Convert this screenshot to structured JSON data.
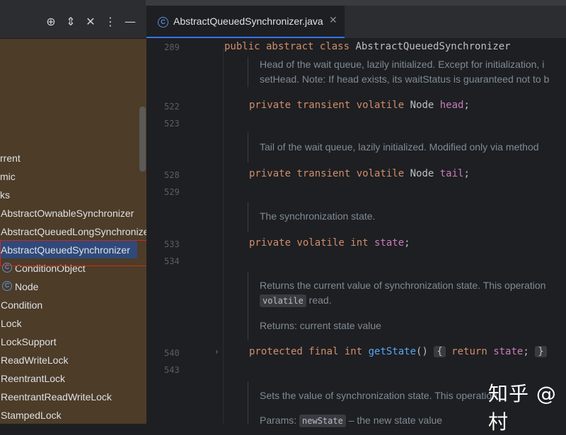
{
  "project": {
    "toolbar_icons": [
      "crosshair-icon",
      "expand-collapse-icon",
      "collapse-all-icon",
      "more-options-icon",
      "minimize-icon"
    ],
    "tree": [
      {
        "label": "rrent",
        "icon": ""
      },
      {
        "label": "mic",
        "icon": ""
      },
      {
        "label": "ks",
        "icon": ""
      },
      {
        "label": "AbstractOwnableSynchronizer",
        "icon": ""
      },
      {
        "label": "AbstractQueuedLongSynchronizer",
        "icon": ""
      },
      {
        "label": "AbstractQueuedSynchronizer",
        "icon": "",
        "selected": true
      },
      {
        "label": "ConditionObject",
        "icon": "class-icon"
      },
      {
        "label": "Node",
        "icon": "class-icon"
      },
      {
        "label": "Condition",
        "icon": ""
      },
      {
        "label": "Lock",
        "icon": ""
      },
      {
        "label": "LockSupport",
        "icon": ""
      },
      {
        "label": "ReadWriteLock",
        "icon": ""
      },
      {
        "label": "ReentrantLock",
        "icon": ""
      },
      {
        "label": "ReentrantReadWriteLock",
        "icon": ""
      },
      {
        "label": "StampedLock",
        "icon": ""
      }
    ]
  },
  "editor": {
    "tab": {
      "title": "AbstractQueuedSynchronizer.java",
      "close": "✕"
    },
    "lines": {
      "l289": "289",
      "l522": "522",
      "l523": "523",
      "l528": "528",
      "l529": "529",
      "l533": "533",
      "l534": "534",
      "l540": "540",
      "l543": "543"
    },
    "code": {
      "class_decl_kw": "public abstract class",
      "class_name": " AbstractQueuedSynchronizer",
      "head_kw": "private transient volatile",
      "head_type": " Node ",
      "head_field": "head",
      "head_semi": ";",
      "tail_kw": "private transient volatile",
      "tail_type": " Node ",
      "tail_field": "tail",
      "tail_semi": ";",
      "state_kw": "private volatile int",
      "state_field": " state",
      "state_semi": ";",
      "getstate_kw": "protected final int",
      "getstate_fn": " getState",
      "getstate_paren": "()",
      "getstate_body_open": "{",
      "getstate_return": " return",
      "getstate_field": " state",
      "getstate_body_close": ";",
      "getstate_brace_close": "}"
    },
    "docs": {
      "head_1": "Head of the wait queue, lazily initialized. Except for initialization, i",
      "head_2": "setHead. Note: If head exists, its waitStatus is guaranteed not to b",
      "tail_1": "Tail of the wait queue, lazily initialized. Modified only via method",
      "state_1": "The synchronization state.",
      "getstate_1": "Returns the current value of synchronization state. This operation",
      "getstate_volatile": "volatile",
      "getstate_read": " read.",
      "getstate_returns": "Returns:  current state value",
      "setstate_1": "Sets the value of synchronization state. This operation",
      "setstate_params": "Params:",
      "setstate_param": "newState",
      "setstate_desc": " – the new state value"
    }
  },
  "watermark": "知乎 @村"
}
